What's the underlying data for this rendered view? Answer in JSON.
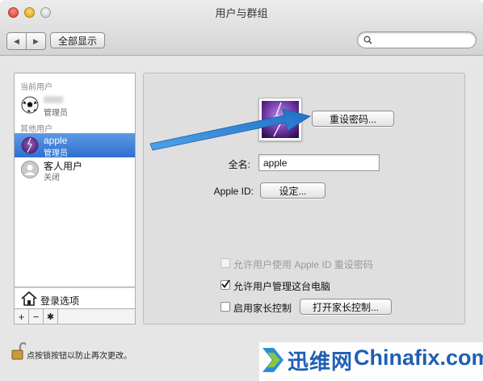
{
  "window": {
    "title": "用户与群组"
  },
  "toolbar": {
    "show_all_label": "全部显示",
    "back_glyph": "◀",
    "forward_glyph": "▶",
    "search_placeholder": ""
  },
  "sidebar": {
    "current_user_header": "当前用户",
    "current_user": {
      "name": "",
      "role": "管理员"
    },
    "other_users_header": "其他用户",
    "users": [
      {
        "name": "apple",
        "role": "管理员",
        "selected": true
      },
      {
        "name": "客人用户",
        "role": "关闭",
        "selected": false
      }
    ],
    "login_options_label": "登录选项",
    "add_glyph": "+",
    "remove_glyph": "−",
    "gear_glyph": "✱"
  },
  "detail": {
    "reset_password_label": "重设密码...",
    "full_name_label": "全名:",
    "full_name_value": "apple",
    "apple_id_label": "Apple ID:",
    "apple_id_button": "设定...",
    "checkboxes": [
      {
        "label": "允许用户使用 Apple ID 重设密码",
        "checked": false,
        "enabled": false
      },
      {
        "label": "允许用户管理这台电脑",
        "checked": true,
        "enabled": true
      },
      {
        "label": "启用家长控制",
        "checked": false,
        "enabled": true
      }
    ],
    "parental_controls_button": "打开家长控制..."
  },
  "footer": {
    "lock_text": "点按锁按钮以防止再次更改。",
    "help_glyph": "?"
  },
  "watermark": {
    "cn": "迅维网",
    "en": "Chinafix.com"
  },
  "colors": {
    "selection": "#3a7bd5",
    "arrow": "#2f86d6",
    "watermark": "#1f5fb3"
  }
}
